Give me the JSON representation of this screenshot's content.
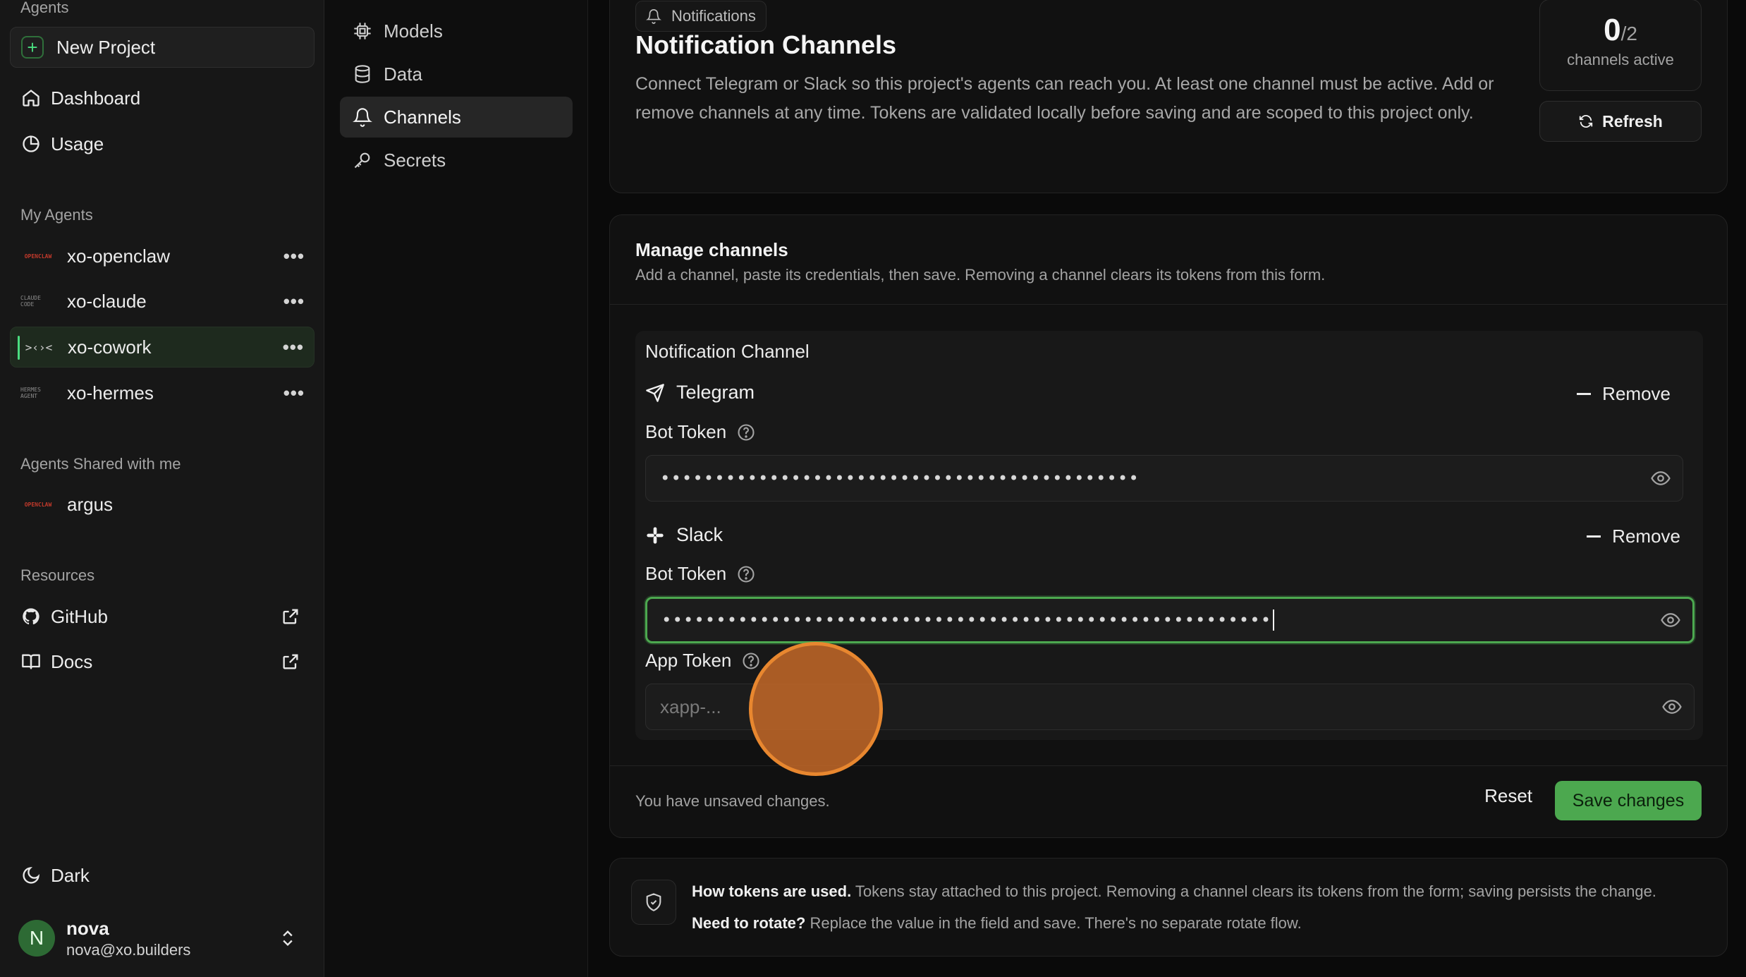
{
  "sidebar": {
    "section_agents": "Agents",
    "new_project": "New Project",
    "nav": [
      {
        "label": "Dashboard",
        "icon": "home-icon"
      },
      {
        "label": "Usage",
        "icon": "pie-chart-icon"
      }
    ],
    "section_my_agents": "My Agents",
    "agents": [
      {
        "name": "xo-openclaw",
        "logo": "OPENCLAW",
        "active": false
      },
      {
        "name": "xo-claude",
        "logo": "CLAUDE CODE",
        "active": false
      },
      {
        "name": "xo-cowork",
        "logo": ">‹›<",
        "active": true
      },
      {
        "name": "xo-hermes",
        "logo": "HERMES AGENT",
        "active": false
      }
    ],
    "section_shared": "Agents Shared with me",
    "shared": [
      {
        "name": "argus",
        "logo": "OPENCLAW"
      }
    ],
    "section_resources": "Resources",
    "resources": [
      {
        "label": "GitHub",
        "icon": "github-icon"
      },
      {
        "label": "Docs",
        "icon": "book-icon"
      }
    ],
    "theme_label": "Dark",
    "user": {
      "initial": "N",
      "name": "nova",
      "email": "nova@xo.builders"
    },
    "more_glyph": "•••"
  },
  "subnav": {
    "items": [
      {
        "label": "Models",
        "icon": "chip-icon",
        "active": false
      },
      {
        "label": "Data",
        "icon": "database-icon",
        "active": false
      },
      {
        "label": "Channels",
        "icon": "bell-icon",
        "active": true
      },
      {
        "label": "Secrets",
        "icon": "key-icon",
        "active": false
      }
    ]
  },
  "header": {
    "pill": "Notifications",
    "title": "Notification Channels",
    "description": "Connect Telegram or Slack so this project's agents can reach you. At least one channel must be active. Add or remove channels at any time. Tokens are validated locally before saving and are scoped to this project only.",
    "stat_value": "0",
    "stat_total": "/2",
    "stat_label": "channels active",
    "refresh": "Refresh"
  },
  "manage": {
    "title": "Manage channels",
    "subtitle": "Add a channel, paste its credentials, then save. Removing a channel clears its tokens from this form.",
    "inner_title": "Notification Channel",
    "remove_label": "Remove",
    "telegram": {
      "name": "Telegram",
      "bot_token_label": "Bot Token",
      "bot_token_value": "••••••••••••••••••••••••••••••••••••••••••••"
    },
    "slack": {
      "name": "Slack",
      "bot_token_label": "Bot Token",
      "bot_token_value": "••••••••••••••••••••••••••••••••••••••••••••••••••••••••",
      "app_token_label": "App Token",
      "app_token_placeholder": "xapp-..."
    },
    "unsaved": "You have unsaved changes.",
    "reset": "Reset",
    "save": "Save changes"
  },
  "info": {
    "line1_bold": "How tokens are used.",
    "line1_text": " Tokens stay attached to this project. Removing a channel clears its tokens from the form; saving persists the change.",
    "line2_bold": "Need to rotate?",
    "line2_text": " Replace the value in the field and save. There's no separate rotate flow."
  },
  "colors": {
    "accent": "#4ca84f",
    "cursor": "#e8872f"
  }
}
